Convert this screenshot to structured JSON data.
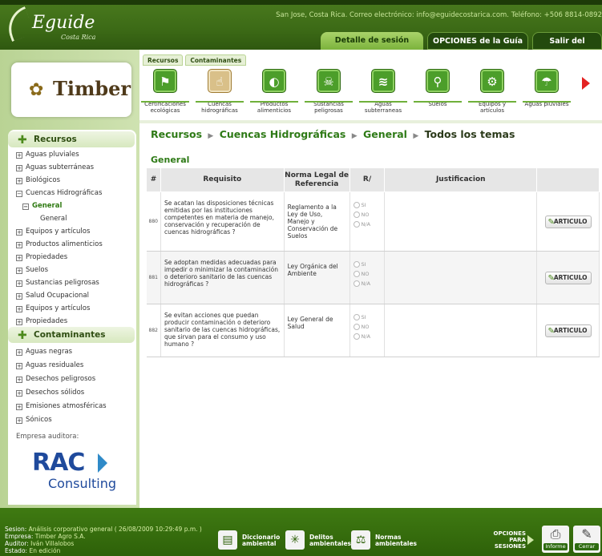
{
  "header": {
    "logo_name": "Eguide",
    "logo_sub": "Costa Rica",
    "contact": "San Jose, Costa Rica.  Correo electrónico: info@eguidecostarica.com. Teléfono: +506 8814-0892",
    "tabs": [
      "Detalle de sesión",
      "OPCIONES de la Guía",
      "Salir del sistema"
    ]
  },
  "company_logo": "Timber",
  "sidebar": {
    "recursos_title": "Recursos",
    "recursos": [
      {
        "label": "Aguas pluviales",
        "box": "+"
      },
      {
        "label": "Aguas subterráneas",
        "box": "+"
      },
      {
        "label": "Biológicos",
        "box": "+"
      },
      {
        "label": "Cuencas Hidrográficas",
        "box": "−"
      },
      {
        "label": "General",
        "box": "−"
      },
      {
        "label": "General",
        "box": ""
      },
      {
        "label": "Equipos y artículos",
        "box": "+"
      },
      {
        "label": "Productos alimenticios",
        "box": "+"
      },
      {
        "label": "Propiedades",
        "box": "+"
      },
      {
        "label": "Suelos",
        "box": "+"
      },
      {
        "label": "Sustancias peligrosas",
        "box": "+"
      },
      {
        "label": "Salud Ocupacional",
        "box": "+"
      },
      {
        "label": "Equipos y artículos",
        "box": "+"
      },
      {
        "label": "Propiedades",
        "box": "+"
      }
    ],
    "contaminantes_title": "Contaminantes",
    "contaminantes": [
      {
        "label": "Aguas negras",
        "box": "+"
      },
      {
        "label": "Aguas residuales",
        "box": "+"
      },
      {
        "label": "Desechos peligrosos",
        "box": "+"
      },
      {
        "label": "Desechos sólidos",
        "box": "+"
      },
      {
        "label": "Emisiones atmosféricas",
        "box": "+"
      },
      {
        "label": "Sónicos",
        "box": "+"
      }
    ],
    "auditora_label": "Empresa auditora:",
    "auditora_logo": "RAC",
    "auditora_logo_sub": "Consulting"
  },
  "subtabs": [
    "Recursos",
    "Contaminantes"
  ],
  "categories": [
    {
      "label": "Certificaciones ecológicas",
      "icon": "flag-icon",
      "glyph": "⚑"
    },
    {
      "label": "Cuencas hidrográficas",
      "icon": "hand-water-icon",
      "glyph": "☝"
    },
    {
      "label": "Productos alimenticios",
      "icon": "food-icon",
      "glyph": "◐"
    },
    {
      "label": "Sustancias peligrosas",
      "icon": "skull-icon",
      "glyph": "☠"
    },
    {
      "label": "Aguas subterraneas",
      "icon": "water-drop-icon",
      "glyph": "≋"
    },
    {
      "label": "Suelos",
      "icon": "soil-icon",
      "glyph": "⚲"
    },
    {
      "label": "Equipos y artículos",
      "icon": "equipment-icon",
      "glyph": "⚙"
    },
    {
      "label": "Aguas pluviales",
      "icon": "rain-icon",
      "glyph": "☂"
    }
  ],
  "breadcrumb": {
    "parts": [
      "Recursos",
      "Cuencas Hidrográficas",
      "General"
    ],
    "current": "Todos los temas"
  },
  "section_title": "General",
  "table": {
    "headers": [
      "#",
      "Requisito",
      "Norma Legal de Referencia",
      "R/",
      "Justificacion",
      ""
    ],
    "rows": [
      {
        "num": "880",
        "requisito": "Se acatan las disposiciones técnicas emitidas por las instituciones competentes en materia de manejo, conservación y recuperación de cuencas hidrográficas ?",
        "norma": "Reglamento a la Ley de Uso, Manejo y Conservación de Suelos"
      },
      {
        "num": "881",
        "requisito": "Se adoptan medidas adecuadas para impedir o minimizar la contaminación o deterioro sanitario de las cuencas hidrográficas ?",
        "norma": "Ley Orgánica del Ambiente"
      },
      {
        "num": "882",
        "requisito": "Se evitan acciones que puedan producir contaminación o deterioro sanitario de las cuencas hidrográficas, que sirvan para el consumo y uso humano ?",
        "norma": "Ley General de Salud"
      }
    ],
    "options": [
      "SI",
      "NO",
      "N/A"
    ],
    "button_label": "ARTICULO"
  },
  "footer": {
    "session_lines": [
      {
        "k": "Sesion:",
        "v": "Análisis corporativo general ( 26/08/2009 10:29:49 p.m. )"
      },
      {
        "k": "Empresa:",
        "v": "Timber Agro S.A."
      },
      {
        "k": "Auditor:",
        "v": "Iván Villalobos"
      },
      {
        "k": "Estado:",
        "v": "En edición"
      }
    ],
    "buttons": [
      {
        "line1": "Diccionario",
        "line2": "ambiental"
      },
      {
        "line1": "Delitos",
        "line2": "ambientales"
      },
      {
        "line1": "Normas",
        "line2": "ambientales"
      }
    ],
    "opciones": [
      "OPCIONES",
      "PARA",
      "SESIONES"
    ],
    "informe": "Informe",
    "cerrar": "Cerrar"
  }
}
